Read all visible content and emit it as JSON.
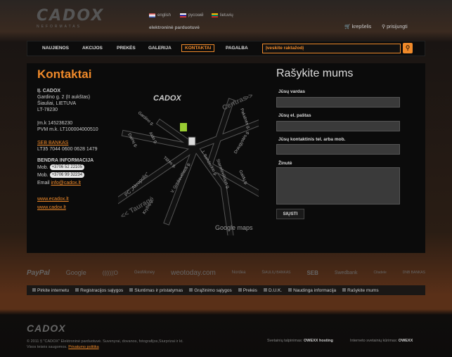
{
  "header": {
    "logo": "CADOX",
    "logo_sub": "NEFORMATAS",
    "tagline": "elektroninė parduotuvė",
    "langs": [
      {
        "label": "english"
      },
      {
        "label": "русский"
      },
      {
        "label": "lietuvių"
      }
    ],
    "cart": "krepšelis",
    "login": "prisijungti"
  },
  "nav": {
    "items": [
      "NAUJIENOS",
      "AKCIJOS",
      "PREKĖS",
      "GALERIJA",
      "KONTAKTAI",
      "PAGALBA"
    ],
    "active": "KONTAKTAI",
    "search_placeholder": "Įveskite raktažodį"
  },
  "contacts": {
    "title": "Kontaktai",
    "company": "IĮ. CADOX",
    "addr1": "Gardino g. 2 (II aukštas)",
    "addr2": "Šiauliai, LIETUVA",
    "zip": "LT-78230",
    "code": "Įm.k 145236230",
    "vat": "PVM m.k. LT100004000510",
    "bank": "SEB BANKAS",
    "account": "LT35 7044 0600 0628 1479",
    "info_title": "BENDRA INFORMACIJA",
    "mob_label": "Mob.",
    "mob1": "+3706 52 22105",
    "mob2": "+3706 99 32234",
    "email_label": "Email",
    "email": "info@cadox.lt",
    "link1": "www.ecadox.lt",
    "link2": "www.cadox.lt"
  },
  "map": {
    "logo": "CADOX",
    "streets": [
      "Gardino g.",
      "Aido g.",
      "Dainų g.",
      "Tilžės g.",
      "J. Sondeckio g.",
      "Stanelevičiaus g.",
      "Gaidų g.",
      "Pakalnės g.",
      "Draugystės g.",
      "V. Grinkevičiaus g.",
      "Kryžių g.",
      "PC „Akropolis\"",
      "Centras",
      ">>",
      "<< Tauragė"
    ],
    "google": "Google maps"
  },
  "form": {
    "title": "Rašykite mums",
    "name": "Jūsų vardas",
    "email": "Jūsų el. paštas",
    "phone": "Jūsų kontaktinis tel. arba mob.",
    "message": "Žinutė",
    "submit": "SIŲSTI"
  },
  "partners": [
    "PayPal",
    "Google",
    "((((((O",
    "GeoMoney",
    "weotoday.com",
    "Nordea",
    "ŠIAULIŲ BANKAS",
    "SEB",
    "Swedbank",
    "Citadele",
    "DNB BANKAS"
  ],
  "footer_nav": [
    "Pirkite internetu",
    "Registracijos sąlygos",
    "Siuntimas ir pristatymas",
    "Grąžinimo sąlygos",
    "Prekės",
    "D.U.K.",
    "Naudinga informacija",
    "Rašykite mums"
  ],
  "footer": {
    "logo": "CADOX",
    "copyright": "© 2011 § \"CADOX\" Elektroninė parduotuvė. Suvenyrai, dovanos, fotografijos,Siurprizai ir kt.",
    "rights": "Visos teisės saugomos.",
    "privacy": "Privatumo politika",
    "hosting_label": "Svetainių talpinimas:",
    "hosting": "OWEXX hosting",
    "design_label": "Interneto svetainių kūrimas:",
    "design": "OWEXX"
  },
  "colors": {
    "accent": "#f08a2a",
    "bg": "#0b0b0b"
  }
}
